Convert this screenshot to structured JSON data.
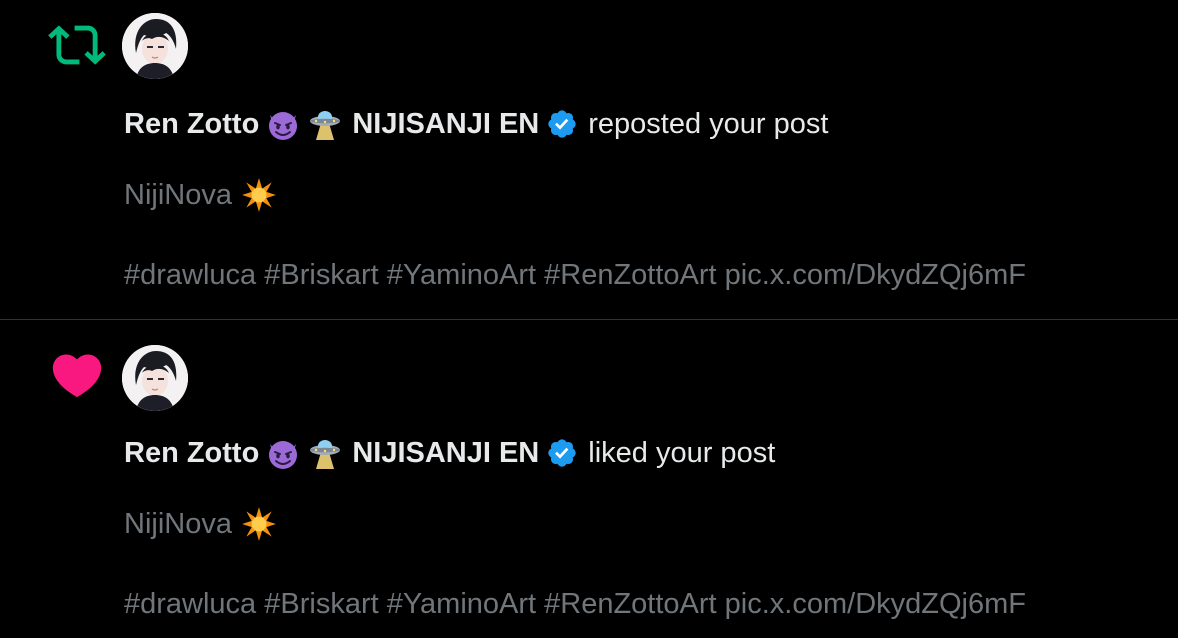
{
  "notifications": [
    {
      "type": "repost",
      "icon": "repost-icon",
      "icon_color": "#00ba7c",
      "user_name": "Ren Zotto",
      "user_suffix": "NIJISANJI EN",
      "name_emojis": [
        "smiling-devil-emoji",
        "ufo-emoji"
      ],
      "verified": true,
      "action_text": "reposted your post",
      "post_title": "NijiNova",
      "post_title_emoji": "glowing-star-emoji",
      "post_body": "#drawluca #Briskart #YaminoArt #RenZottoArt pic.x.com/DkydZQj6mF"
    },
    {
      "type": "like",
      "icon": "heart-icon",
      "icon_color": "#f91880",
      "user_name": "Ren Zotto",
      "user_suffix": "NIJISANJI EN",
      "name_emojis": [
        "smiling-devil-emoji",
        "ufo-emoji"
      ],
      "verified": true,
      "action_text": "liked your post",
      "post_title": "NijiNova",
      "post_title_emoji": "glowing-star-emoji",
      "post_body": "#drawluca #Briskart #YaminoArt #RenZottoArt pic.x.com/DkydZQj6mF"
    }
  ],
  "colors": {
    "background": "#000000",
    "primary_text": "#e7e9ea",
    "secondary_text": "#71767b",
    "verified_blue": "#1d9bf0",
    "divider": "#2f3336"
  }
}
